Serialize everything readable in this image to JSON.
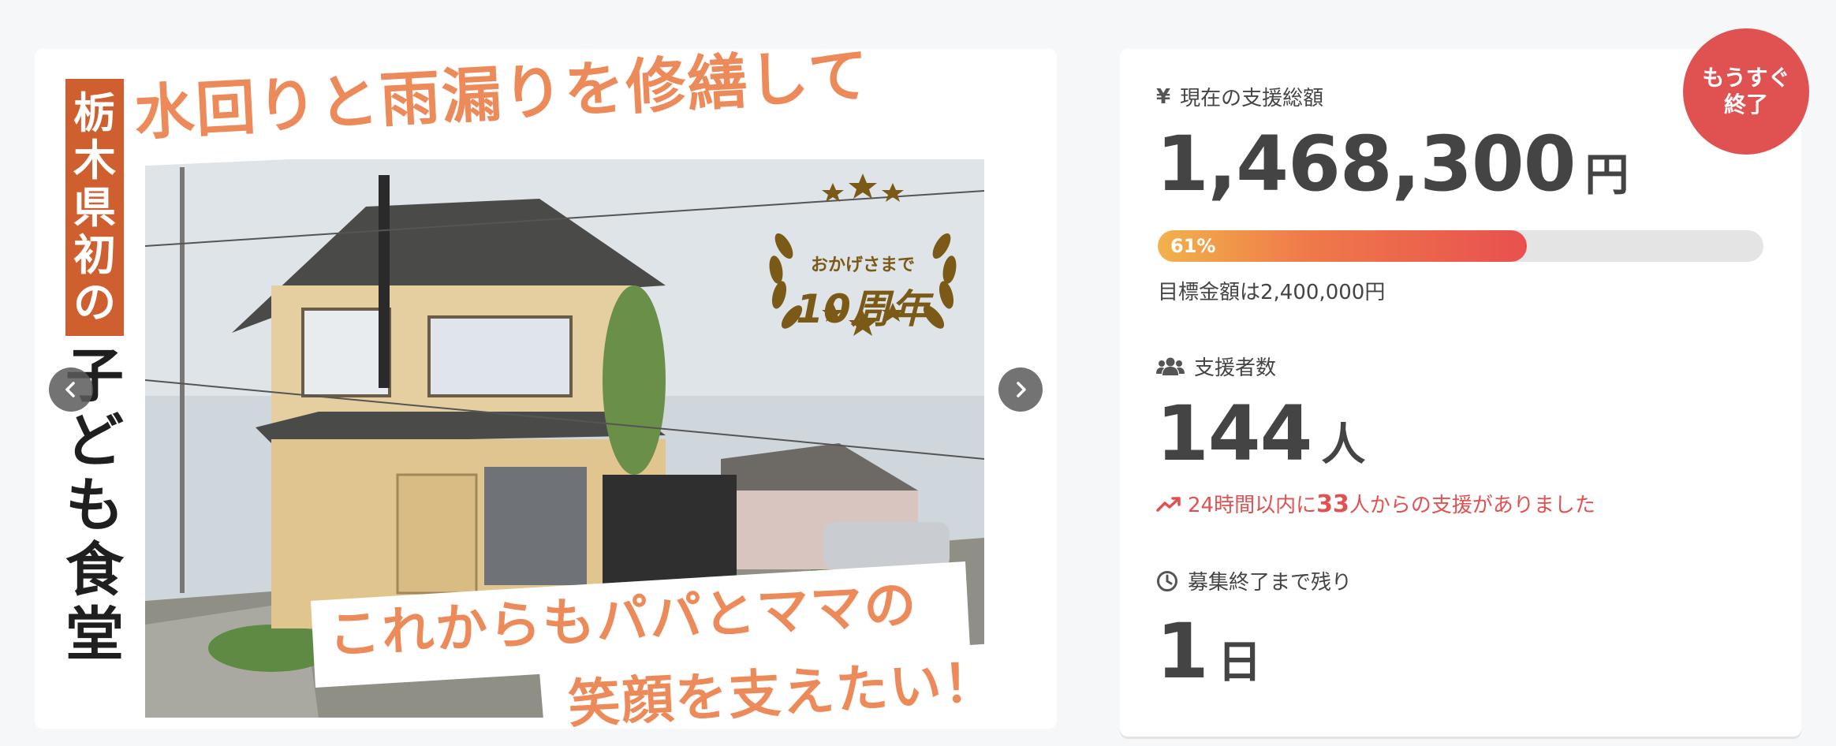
{
  "hero": {
    "side_title_top": [
      "栃",
      "木",
      "県",
      "初",
      "の"
    ],
    "side_title_bottom": [
      "子",
      "ど",
      "も",
      "食",
      "堂"
    ],
    "headline_top": "水回りと雨漏りを修繕して",
    "headline_bottom_1": "これからもパパとママの",
    "headline_bottom_2": "笑顔を支えたい！",
    "anniversary_sub": "おかげさまで",
    "anniversary_main": "10周年",
    "prev_icon": "chevron-left-icon",
    "next_icon": "chevron-right-icon"
  },
  "badge": {
    "line1": "もうすぐ",
    "line2": "終了"
  },
  "total": {
    "icon": "yen-icon",
    "icon_glyph": "¥",
    "label": "現在の支援総額",
    "amount": "1,468,300",
    "unit": "円",
    "progress_percent": 61,
    "progress_label": "61%",
    "goal": "目標金額は2,400,000円"
  },
  "supporters": {
    "icon": "users-icon",
    "label": "支援者数",
    "count": "144",
    "unit": "人",
    "trend_icon": "trending-up-icon",
    "trend_prefix": "24時間以内に",
    "trend_count": "33",
    "trend_suffix": "人からの支援がありました"
  },
  "remaining": {
    "icon": "clock-icon",
    "label": "募集終了まで残り",
    "value": "1",
    "unit": "日"
  },
  "colors": {
    "accent": "#e05252",
    "orange_text": "#ec8a5a",
    "title_bg": "#cf5f2f",
    "gold": "#7a5a16",
    "progress_start": "#f2b24a",
    "progress_end": "#e8504f"
  }
}
